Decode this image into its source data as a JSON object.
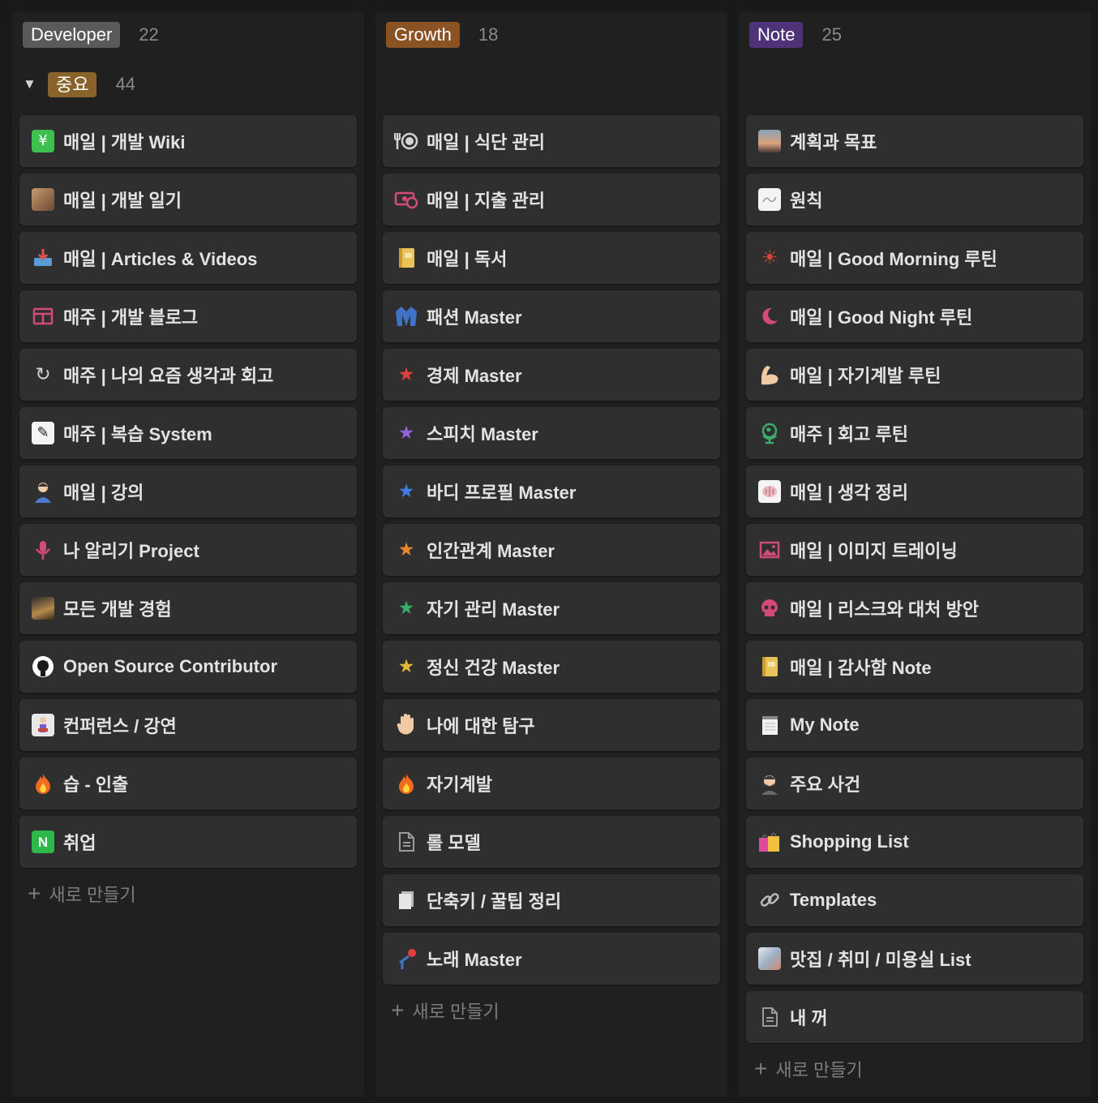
{
  "columns": [
    {
      "name": "Developer",
      "count": "22",
      "color": "#5a5a5a"
    },
    {
      "name": "Growth",
      "count": "18",
      "color": "#8b5224"
    },
    {
      "name": "Note",
      "count": "25",
      "color": "#4e3378"
    }
  ],
  "group": {
    "name": "중요",
    "count": "44",
    "color": "#89632a"
  },
  "new_label": "새로 만들기",
  "developer_cards": [
    {
      "label": "매일 | 개발 Wiki",
      "icon": "chart-icon"
    },
    {
      "label": "매일 | 개발 일기",
      "icon": "photo-icon"
    },
    {
      "label": "매일 | Articles & Videos",
      "icon": "inbox-tray-icon"
    },
    {
      "label": "매주 | 개발 블로그",
      "icon": "browser-window-icon"
    },
    {
      "label": "매주 | 나의 요즘 생각과 회고",
      "icon": "rotate-arrow-icon"
    },
    {
      "label": "매주 | 복습 System",
      "icon": "feather-icon"
    },
    {
      "label": "매일 | 강의",
      "icon": "teacher-icon"
    },
    {
      "label": "나 알리기 Project",
      "icon": "microphone-icon"
    },
    {
      "label": "모든 개발 경험",
      "icon": "photo-icon"
    },
    {
      "label": "Open Source Contributor",
      "icon": "github-icon"
    },
    {
      "label": "컨퍼런스 / 강연",
      "icon": "speaker-icon"
    },
    {
      "label": "습 - 인출",
      "icon": "fire-icon"
    },
    {
      "label": "취업",
      "icon": "naver-icon"
    }
  ],
  "growth_cards": [
    {
      "label": "매일 | 식단 관리",
      "icon": "fork-plate-icon"
    },
    {
      "label": "매일 | 지출 관리",
      "icon": "money-icon"
    },
    {
      "label": "매일 | 독서",
      "icon": "notebook-icon"
    },
    {
      "label": "패션 Master",
      "icon": "jacket-icon"
    },
    {
      "label": "경제 Master",
      "icon": "star-red-icon"
    },
    {
      "label": "스피치 Master",
      "icon": "star-purple-icon"
    },
    {
      "label": "바디 프로필 Master",
      "icon": "star-blue-icon"
    },
    {
      "label": "인간관계 Master",
      "icon": "star-orange-icon"
    },
    {
      "label": "자기 관리 Master",
      "icon": "star-green-icon"
    },
    {
      "label": "정신 건강 Master",
      "icon": "star-yellow-icon"
    },
    {
      "label": "나에 대한 탐구",
      "icon": "raised-hand-icon"
    },
    {
      "label": "자기계발",
      "icon": "fire-icon"
    },
    {
      "label": "롤 모델",
      "icon": "document-icon"
    },
    {
      "label": "단축키 / 꿀팁 정리",
      "icon": "pages-icon"
    },
    {
      "label": "노래 Master",
      "icon": "microphone-stand-icon"
    }
  ],
  "note_cards": [
    {
      "label": "계획과 목표",
      "icon": "landscape-icon"
    },
    {
      "label": "원칙",
      "icon": "sketch-icon"
    },
    {
      "label": "매일 | Good Morning 루틴",
      "icon": "sun-icon"
    },
    {
      "label": "매일 | Good Night 루틴",
      "icon": "moon-icon"
    },
    {
      "label": "매일 | 자기계발 루틴",
      "icon": "flexed-arm-icon"
    },
    {
      "label": "매주 | 회고 루틴",
      "icon": "globe-icon"
    },
    {
      "label": "매일 | 생각 정리",
      "icon": "brain-icon"
    },
    {
      "label": "매일 | 이미지 트레이닝",
      "icon": "image-icon"
    },
    {
      "label": "매일 | 리스크와 대처 방안",
      "icon": "skull-icon"
    },
    {
      "label": "매일 | 감사함 Note",
      "icon": "notebook-icon"
    },
    {
      "label": "My Note",
      "icon": "notepad-icon"
    },
    {
      "label": "주요 사건",
      "icon": "man-icon"
    },
    {
      "label": "Shopping List",
      "icon": "shopping-bags-icon"
    },
    {
      "label": "Templates",
      "icon": "link-icon"
    },
    {
      "label": "맛집 / 취미 / 미용실 List",
      "icon": "photo-icon"
    },
    {
      "label": "내 꺼",
      "icon": "document-icon"
    }
  ]
}
